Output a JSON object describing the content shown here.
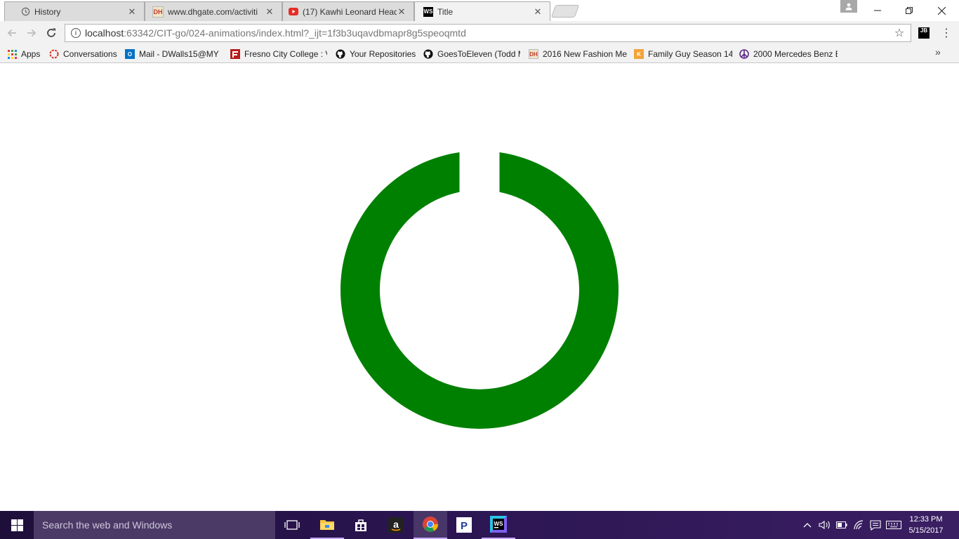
{
  "tabs": [
    {
      "title": "History",
      "icon": "history-icon"
    },
    {
      "title": "www.dhgate.com/activiti",
      "icon": "dhgate-icon",
      "icon_text": "DH"
    },
    {
      "title": "(17) Kawhi Leonard Head",
      "icon": "youtube-icon"
    },
    {
      "title": "Title",
      "icon": "webstorm-icon",
      "icon_text": "WS"
    }
  ],
  "toolbar": {
    "url_host": "localhost",
    "url_rest": ":63342/CIT-go/024-animations/index.html?_ijt=1f3b3uqavdbmapr8g5speoqmtd",
    "extension_label": "JB"
  },
  "bookmarks": [
    {
      "label": "Apps",
      "icon": "apps-grid-icon"
    },
    {
      "label": "Conversations",
      "icon": "conversations-icon"
    },
    {
      "label": "Mail - DWalls15@MY",
      "icon": "outlook-icon",
      "icon_text": "O"
    },
    {
      "label": "Fresno City College : V",
      "icon": "fresno-college-icon"
    },
    {
      "label": "Your Repositories",
      "icon": "github-icon"
    },
    {
      "label": "GoesToEleven (Todd M",
      "icon": "github-icon"
    },
    {
      "label": "2016 New Fashion Me",
      "icon": "dhgate-icon",
      "icon_text": "DH"
    },
    {
      "label": "Family Guy Season 14",
      "icon": "k-icon",
      "icon_text": "K"
    },
    {
      "label": "2000 Mercedes Benz E",
      "icon": "peace-icon"
    }
  ],
  "taskbar": {
    "search_placeholder": "Search the web and Windows",
    "time": "12:33 PM",
    "date": "5/15/2017"
  },
  "colors": {
    "ring": "#008000",
    "taskbar": "#2b1551"
  }
}
